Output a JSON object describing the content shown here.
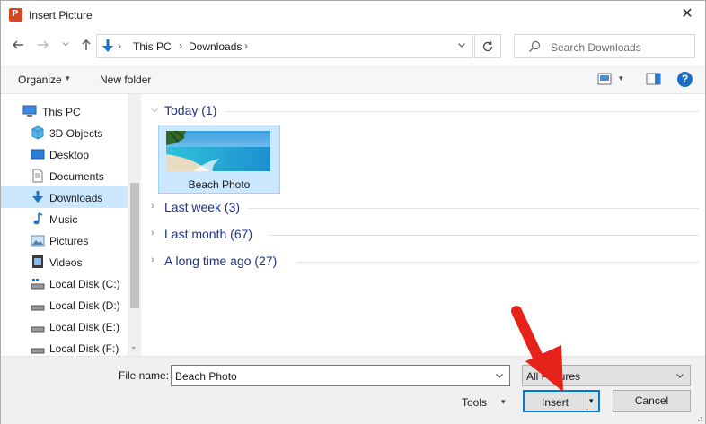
{
  "window": {
    "title": "Insert Picture",
    "close_glyph": "✕"
  },
  "address": {
    "crumbs": [
      "This PC",
      "Downloads"
    ],
    "separator": "›",
    "dropdown_glyph": "⌄",
    "refresh_glyph": "↻"
  },
  "search": {
    "placeholder": "Search Downloads"
  },
  "toolbar": {
    "organize_label": "Organize",
    "caret": "▾",
    "new_folder_label": "New folder",
    "help_label": "?"
  },
  "sidebar": {
    "items": [
      {
        "label": "This PC",
        "icon": "computer-icon"
      },
      {
        "label": "3D Objects",
        "icon": "cube-icon"
      },
      {
        "label": "Desktop",
        "icon": "desktop-icon"
      },
      {
        "label": "Documents",
        "icon": "document-icon"
      },
      {
        "label": "Downloads",
        "icon": "download-icon",
        "selected": true
      },
      {
        "label": "Music",
        "icon": "music-icon"
      },
      {
        "label": "Pictures",
        "icon": "pictures-icon"
      },
      {
        "label": "Videos",
        "icon": "video-icon"
      },
      {
        "label": "Local Disk (C:)",
        "icon": "drive-icon"
      },
      {
        "label": "Local Disk (D:)",
        "icon": "drive-icon"
      },
      {
        "label": "Local Disk (E:)",
        "icon": "drive-icon"
      },
      {
        "label": "Local Disk (F:)",
        "icon": "drive-icon"
      }
    ],
    "scroll_down_glyph": "⌄"
  },
  "content": {
    "groups": [
      {
        "label": "Today (1)",
        "expanded": true
      },
      {
        "label": "Last week (3)",
        "expanded": false
      },
      {
        "label": "Last month (67)",
        "expanded": false
      },
      {
        "label": "A long time ago (27)",
        "expanded": false
      }
    ],
    "files": [
      {
        "name": "Beach Photo"
      }
    ],
    "chevron_expanded": "⌵",
    "chevron_collapsed": "›"
  },
  "footer": {
    "file_name_label": "File name:",
    "file_name_value": "Beach Photo",
    "file_type_value": "All Pictures",
    "tools_label": "Tools",
    "insert_label": "Insert",
    "cancel_label": "Cancel",
    "caret": "▾"
  },
  "colors": {
    "accent": "#0078d7",
    "selection": "#cce8ff",
    "group_text": "#1e3287",
    "annotation": "#e5231b"
  }
}
